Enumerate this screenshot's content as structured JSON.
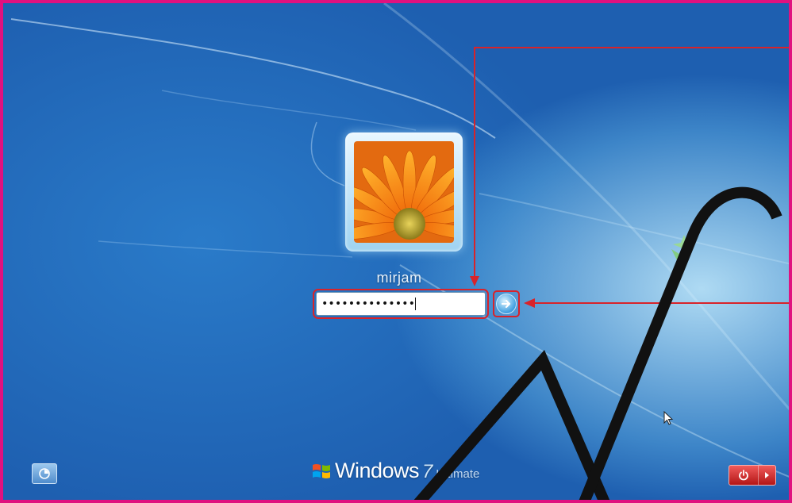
{
  "login": {
    "username": "mirjam",
    "password_masked": "••••••••••••••"
  },
  "branding": {
    "word": "Windows",
    "version": "7",
    "edition": "Ultimate"
  },
  "colors": {
    "frame_border": "#e0117f",
    "annotation": "#d8232a",
    "background": "#2a7bc9"
  },
  "icons": {
    "submit": "arrow-right-icon",
    "ease_of_access": "ease-of-access-icon",
    "power": "power-icon",
    "power_menu": "chevron-right-icon",
    "logo": "windows-logo-icon",
    "cursor": "mouse-pointer-icon"
  }
}
